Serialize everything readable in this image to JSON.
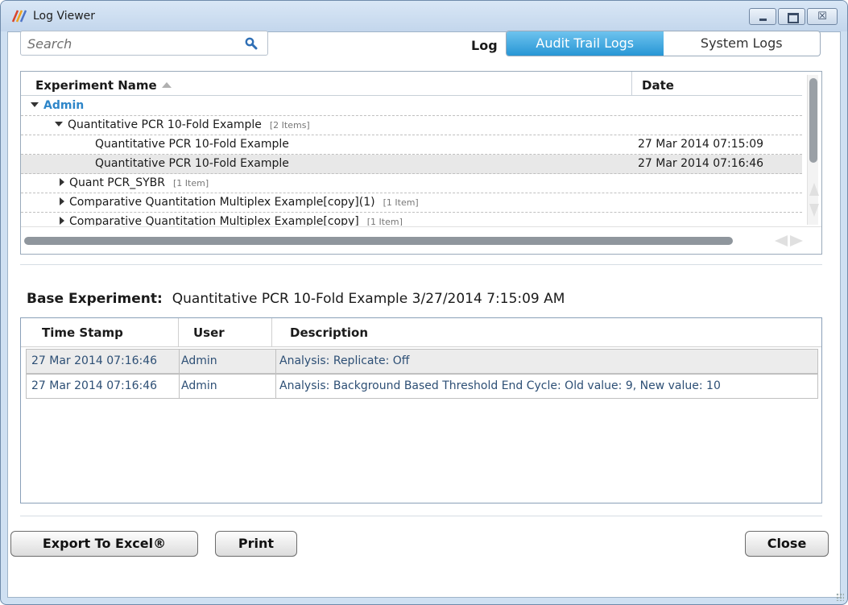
{
  "window": {
    "title": "Log Viewer",
    "close_glyph": "☒"
  },
  "search": {
    "placeholder": "Search",
    "icon": "search-icon"
  },
  "log_selector": {
    "label": "Log",
    "options": [
      "Audit Trail Logs",
      "System Logs"
    ],
    "selected": "Audit Trail Logs"
  },
  "tree": {
    "columns": {
      "name": "Experiment Name",
      "date": "Date"
    },
    "rows": [
      {
        "text": "Admin",
        "level": 0,
        "expanded": true
      },
      {
        "text": "Quantitative PCR 10-Fold Example",
        "count": "[2 Items]",
        "level": 1,
        "expanded": true
      },
      {
        "text": "Quantitative PCR 10-Fold Example",
        "date": "27 Mar 2014  07:15:09",
        "level": 2
      },
      {
        "text": "Quantitative PCR 10-Fold Example",
        "date": "27 Mar 2014  07:16:46",
        "level": 2,
        "selected": true
      },
      {
        "text": "Quant PCR_SYBR",
        "count": "[1 Item]",
        "level": 1,
        "expanded": false
      },
      {
        "text": "Comparative Quantitation Multiplex Example[copy](1)",
        "count": "[1 Item]",
        "level": 1,
        "expanded": false
      },
      {
        "text": "Comparative Quantitation Multiplex Example[copy]",
        "count": "[1 Item]",
        "level": 1,
        "expanded": false
      }
    ]
  },
  "base_experiment": {
    "label": "Base Experiment:",
    "value": "Quantitative PCR 10-Fold Example 3/27/2014 7:15:09 AM"
  },
  "audit_table": {
    "columns": [
      "Time Stamp",
      "User",
      "Description"
    ],
    "rows": [
      {
        "time": "27 Mar 2014  07:16:46",
        "user": "Admin",
        "description": "Analysis: Replicate: Off"
      },
      {
        "time": "27 Mar 2014  07:16:46",
        "user": "Admin",
        "description": "Analysis: Background Based Threshold End Cycle: Old value: 9, New value: 10"
      }
    ]
  },
  "buttons": {
    "export": "Export To Excel®",
    "print": "Print",
    "close": "Close"
  },
  "colors": {
    "accent": "#2796d5",
    "link": "#2e86c9",
    "window_frame": "#cfe0f2"
  }
}
